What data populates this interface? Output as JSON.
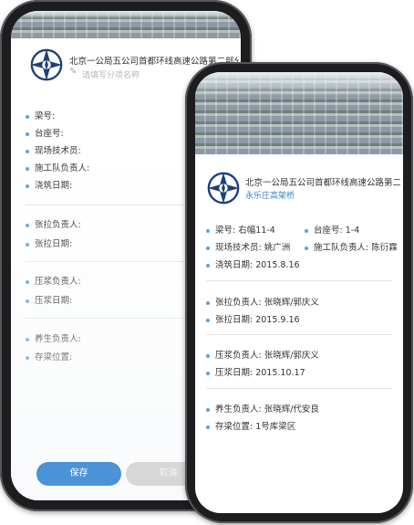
{
  "back_screen": {
    "title": "北京一公局五公司首都环线高速公路第二部分",
    "bridge_placeholder": "请填写分项名称",
    "fields": {
      "beam_no": "梁号:",
      "bearing_no": "台座号:",
      "site_tech": "现场技术员:",
      "team_lead": "施工队负责人:",
      "pour_date": "浇筑日期:",
      "tension_lead": "张拉负责人:",
      "tension_date": "张拉日期:",
      "grout_lead": "压浆负责人:",
      "grout_date": "压浆日期:",
      "cure_lead": "养生负责人:",
      "storage": "存梁位置:"
    },
    "save_label": "保存",
    "cancel_label": "取消"
  },
  "front_screen": {
    "title": "北京一公局五公司首都环线高速公路第二部分",
    "bridge_name": "永乐庄高架桥",
    "fields": {
      "beam_no": "梁号: 右幅11-4",
      "bearing_no": "台座号: 1-4",
      "site_tech": "现场技术员: 姚广洲",
      "team_lead": "施工队负责人: 陈衍霖",
      "pour_date": "浇筑日期: 2015.8.16",
      "tension_lead": "张拉负责人: 张晓辉/郭庆义",
      "tension_date": "张拉日期: 2015.9.16",
      "grout_lead": "压浆负责人: 张晓辉/郭庆义",
      "grout_date": "压浆日期: 2015.10.17",
      "cure_lead": "养生负责人: 张晓辉/代安良",
      "storage": "存梁位置: 1号库梁区"
    }
  }
}
